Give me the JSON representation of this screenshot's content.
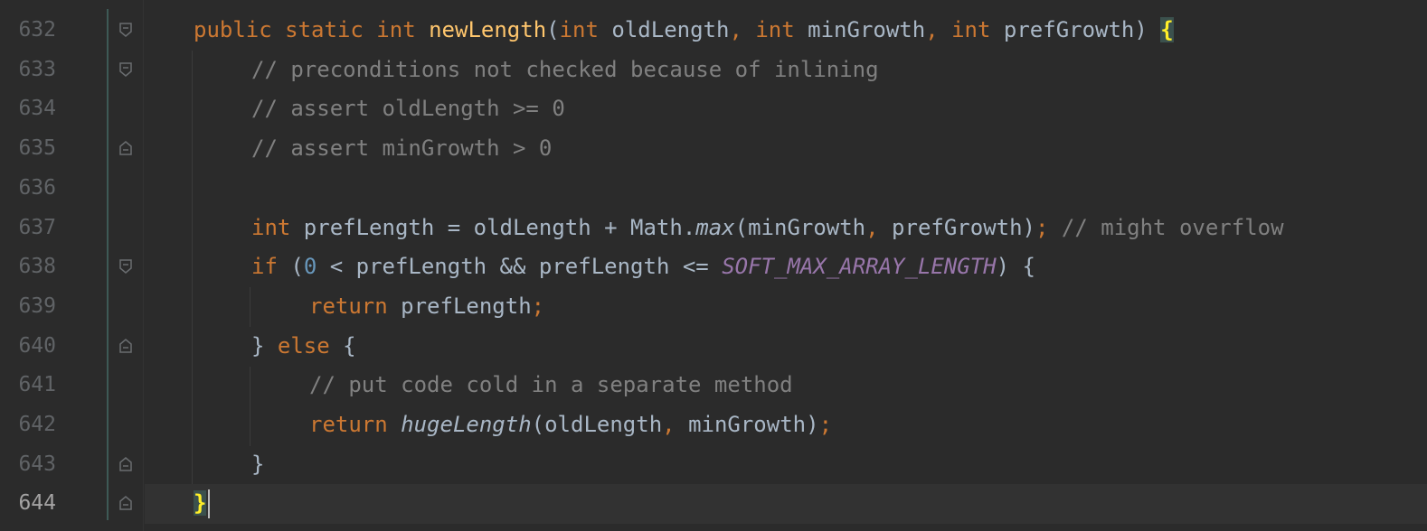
{
  "editor": {
    "lines": [
      {
        "number": "632",
        "parts": [
          [
            "kw",
            "public static int "
          ],
          [
            "fn",
            "newLength"
          ],
          [
            "p",
            "("
          ],
          [
            "kw",
            "int "
          ],
          [
            "p",
            "oldLength"
          ],
          [
            "punc",
            ", "
          ],
          [
            "kw",
            "int "
          ],
          [
            "p",
            "minGrowth"
          ],
          [
            "punc",
            ", "
          ],
          [
            "kw",
            "int "
          ],
          [
            "p",
            "prefGrowth) "
          ],
          [
            "brace",
            "{"
          ]
        ]
      },
      {
        "number": "633",
        "parts": [
          [
            "cm",
            "// preconditions not checked because of inlining"
          ]
        ]
      },
      {
        "number": "634",
        "parts": [
          [
            "cm",
            "// assert oldLength >= 0"
          ]
        ]
      },
      {
        "number": "635",
        "parts": [
          [
            "cm",
            "// assert minGrowth > 0"
          ]
        ]
      },
      {
        "number": "636",
        "parts": []
      },
      {
        "number": "637",
        "parts": [
          [
            "kw",
            "int "
          ],
          [
            "p",
            "prefLength = oldLength + Math."
          ],
          [
            "it",
            "max"
          ],
          [
            "p",
            "(minGrowth"
          ],
          [
            "punc",
            ", "
          ],
          [
            "p",
            "prefGrowth)"
          ],
          [
            "punc",
            "; "
          ],
          [
            "cm",
            "// might overflow"
          ]
        ]
      },
      {
        "number": "638",
        "parts": [
          [
            "kw",
            "if "
          ],
          [
            "p",
            "("
          ],
          [
            "num",
            "0"
          ],
          [
            "p",
            " < prefLength && prefLength <= "
          ],
          [
            "const",
            "SOFT_MAX_ARRAY_LENGTH"
          ],
          [
            "p",
            ") {"
          ]
        ]
      },
      {
        "number": "639",
        "parts": [
          [
            "kw",
            "return "
          ],
          [
            "p",
            "prefLength"
          ],
          [
            "punc",
            ";"
          ]
        ]
      },
      {
        "number": "640",
        "parts": [
          [
            "p",
            "} "
          ],
          [
            "kw",
            "else "
          ],
          [
            "p",
            "{"
          ]
        ]
      },
      {
        "number": "641",
        "parts": [
          [
            "cm",
            "// put code cold in a separate method"
          ]
        ]
      },
      {
        "number": "642",
        "parts": [
          [
            "kw",
            "return "
          ],
          [
            "it",
            "hugeLength"
          ],
          [
            "p",
            "(oldLength"
          ],
          [
            "punc",
            ", "
          ],
          [
            "p",
            "minGrowth)"
          ],
          [
            "punc",
            ";"
          ]
        ]
      },
      {
        "number": "643",
        "parts": [
          [
            "p",
            "}"
          ]
        ]
      },
      {
        "number": "644",
        "parts": [
          [
            "brace",
            "}"
          ]
        ]
      }
    ]
  }
}
